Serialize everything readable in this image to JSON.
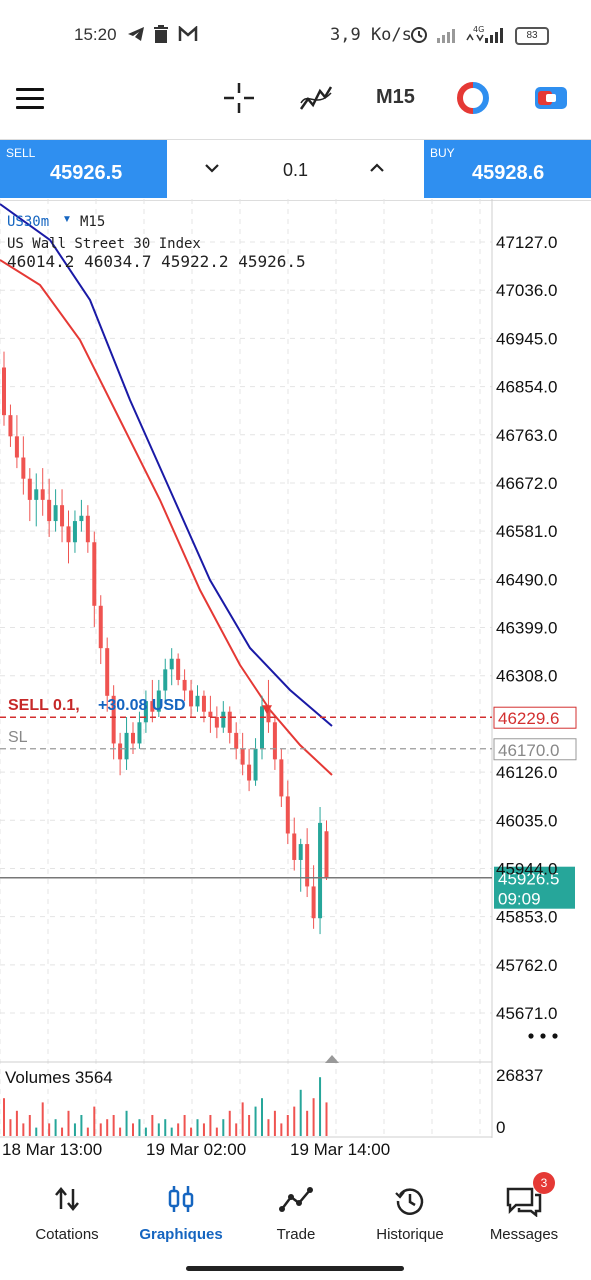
{
  "status_bar": {
    "time": "15:20",
    "net_speed": "3,9 Ko/s",
    "network": "4G",
    "battery": "83",
    "icons": [
      "telegram-icon",
      "trash-icon",
      "gmail-icon",
      "alarm-icon",
      "signal-icon",
      "battery-icon"
    ]
  },
  "toolbar": {
    "timeframe": "M15",
    "icons": [
      "menu-icon",
      "crosshair-icon",
      "indicators-icon",
      "objects-icon",
      "trade-icon"
    ]
  },
  "trade": {
    "sell_label": "SELL",
    "sell_price": "45926.5",
    "lot": "0.1",
    "buy_label": "BUY",
    "buy_price": "45928.6"
  },
  "chart": {
    "symbol": "US30m",
    "symbol_timeframe": "M15",
    "description": "US Wall Street 30 Index",
    "ohlc": "46014.2 46034.7 45922.2 45926.5",
    "position_label": "SELL 0.1,",
    "position_profit": "+30.08 USD",
    "position_price": "46229.6",
    "sl_label": "SL",
    "sl_price": "46170.0",
    "current_price": "45926.5",
    "countdown": "09:09",
    "price_levels": [
      "47127.0",
      "47036.0",
      "46945.0",
      "46854.0",
      "46763.0",
      "46672.0",
      "46581.0",
      "46490.0",
      "46399.0",
      "46308.0",
      "46126.0",
      "46035.0",
      "45944.0",
      "45853.0",
      "45762.0",
      "45671.0"
    ],
    "volume_label": "Volumes 3564",
    "volume_max": "26837",
    "volume_min": "0",
    "time_labels": [
      "18 Mar 13:00",
      "19 Mar 02:00",
      "19 Mar 14:00"
    ],
    "colors": {
      "bull": "#26a69a",
      "bear": "#ef5350",
      "ma_fast": "#e53935",
      "ma_slow": "#1a1aa6",
      "accent": "#2f8ff0",
      "price_tag": "#26a69a"
    }
  },
  "nav": {
    "items": [
      {
        "label": "Cotations",
        "icon": "quotes-icon"
      },
      {
        "label": "Graphiques",
        "icon": "chart-icon"
      },
      {
        "label": "Trade",
        "icon": "trade-icon"
      },
      {
        "label": "Historique",
        "icon": "history-icon"
      },
      {
        "label": "Messages",
        "icon": "messages-icon"
      }
    ],
    "active": "Graphiques",
    "messages_badge": "3"
  }
}
